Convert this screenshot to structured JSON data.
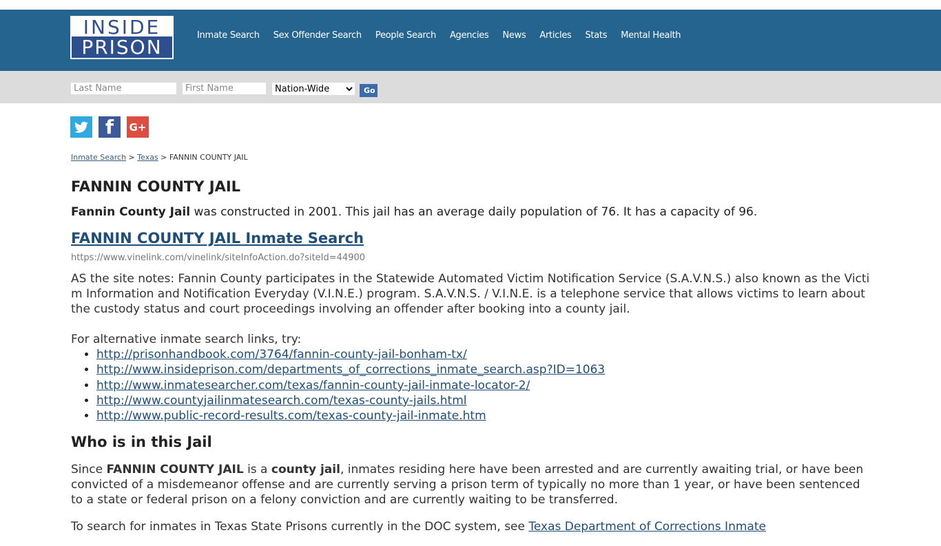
{
  "logo": {
    "line1": "INSIDE",
    "line2": "PRISON"
  },
  "nav": [
    "Inmate Search",
    "Sex Offender Search",
    "People Search",
    "Agencies",
    "News",
    "Articles",
    "Stats",
    "Mental Health"
  ],
  "search": {
    "last_placeholder": "Last Name",
    "first_placeholder": "First Name",
    "scope_selected": "Nation-Wide",
    "go_label": "Go"
  },
  "social": {
    "twitter": "twitter-icon",
    "facebook": "f",
    "google": "G+"
  },
  "breadcrumb": {
    "item1": "Inmate Search",
    "sep": ">",
    "item2": "Texas",
    "current": "FANNIN COUNTY JAIL"
  },
  "page_title": "FANNIN COUNTY JAIL",
  "intro": {
    "bold": "Fannin County Jail",
    "rest": " was constructed in 2001. This jail has an average daily population of 76. It has a capacity of 96."
  },
  "search_link": {
    "label": "FANNIN COUNTY JAIL Inmate Search",
    "url": "https://www.vinelink.com/vinelink/siteInfoAction.do?siteId=44900"
  },
  "notes": "AS the site notes: Fannin County participates in the Statewide Automated Victim Notification Service (S.A.V.N.S.) also known as the Victim Information and Notification Everyday (V.I.N.E.) program. S.A.V.N.S. / V.I.N.E. is a telephone service that allows victims to learn about the custody status and court proceedings involving an offender after booking into a county jail.",
  "alt_intro": "For alternative inmate search links, try:",
  "alt_links": [
    "http://prisonhandbook.com/3764/fannin-county-jail-bonham-tx/",
    "http://www.insideprison.com/departments_of_corrections_inmate_search.asp?ID=1063",
    "http://www.inmatesearcher.com/texas/fannin-county-jail-inmate-locator-2/",
    "http://www.countyjailinmatesearch.com/texas-county-jails.html",
    "http://www.public-record-results.com/texas-county-jail-inmate.htm"
  ],
  "who": {
    "heading": "Who is in this Jail",
    "p1_a": "Since ",
    "p1_b": "FANNIN COUNTY JAIL",
    "p1_c": " is a ",
    "p1_d": "county jail",
    "p1_e": ", inmates residing here have been arrested and are currently awaiting trial, or have been convicted of a misdemeanor offense and are currently serving a prison term of typically no more than 1 year, or have been sentenced to a state or federal prison on a felony conviction and are currently waiting to be transferred.",
    "p2_text": "To search for inmates in Texas State Prisons currently in the DOC system, see ",
    "p2_link": "Texas Department of Corrections Inmate"
  }
}
